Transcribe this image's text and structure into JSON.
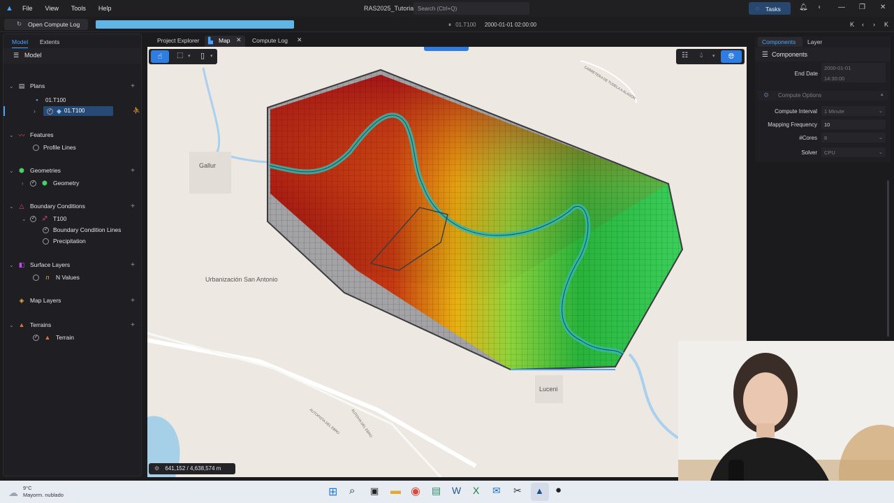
{
  "titlebar": {
    "menu": [
      "File",
      "View",
      "Tools",
      "Help"
    ],
    "app_title": "RAS2025_Tutorial",
    "search_placeholder": "Search (Ctrl+Q)",
    "tasks_label": "Tasks"
  },
  "toolbar": {
    "open_compute_log": "Open Compute Log",
    "progress": 1.0,
    "time_code": "01.T100",
    "time_value": "2000-01-01 02:00:00",
    "nav": [
      "K",
      "‹",
      "›",
      "K"
    ]
  },
  "left_panel": {
    "tabs": [
      "Model",
      "Extents"
    ],
    "header": "Model",
    "tree": {
      "plans": "Plans",
      "plan_group": "01.T100",
      "plan_item": "01.T100",
      "features": "Features",
      "profile_lines": "Profile Lines",
      "geometries": "Geometries",
      "geometry": "Geometry",
      "boundary_conditions": "Boundary Conditions",
      "t100": "T100",
      "bc_lines": "Boundary Condition Lines",
      "precipitation": "Precipitation",
      "surface_layers": "Surface Layers",
      "n_values": "N Values",
      "map_layers": "Map Layers",
      "terrains": "Terrains",
      "terrain": "Terrain"
    }
  },
  "center_tabs": {
    "project_explorer": "Project Explorer",
    "map": "Map",
    "compute_log": "Compute Log"
  },
  "map": {
    "labels": {
      "gallur": "Gallur",
      "urbanizacion": "Urbanización San Antonio",
      "luceni": "Luceni",
      "carretera": "CARRETERA DE TUDELA A ALAGÓN",
      "autopista": "AUTOPISTA DEL EBRO",
      "autovia": "AUTOVIA DEL EBRO"
    },
    "coordinates": "641,152  /  4,638,574 m"
  },
  "right_panel": {
    "tabs": [
      "Components",
      "Layer"
    ],
    "header": "Components",
    "end_date_label": "End Date",
    "end_date_value": "2000-01-01",
    "end_time_value": "14:30:00",
    "compute_options": "Compute Options",
    "compute_interval_label": "Compute Interval",
    "compute_interval_value": "1 Minute",
    "mapping_frequency_label": "Mapping Frequency",
    "mapping_frequency_value": "10",
    "cores_label": "#Cores",
    "cores_value": "8",
    "solver_label": "Solver",
    "solver_value": "CPU"
  },
  "taskbar": {
    "temperature": "9°C",
    "weather": "Mayorm. nublado"
  },
  "colors": {
    "accent": "#2f7de1",
    "progress": "#5fb6e6",
    "background": "#1b1b1e"
  }
}
